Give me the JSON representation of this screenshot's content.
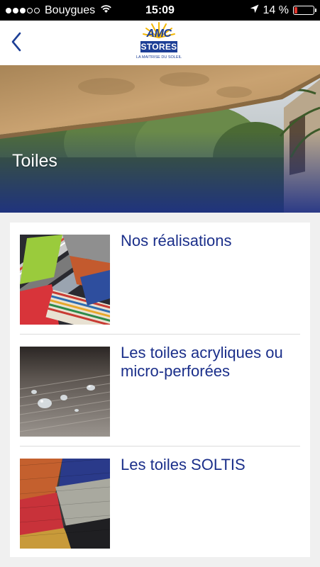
{
  "status_bar": {
    "carrier": "Bouygues",
    "time": "15:09",
    "battery_text": "14 %",
    "battery_level": 0.14,
    "signal_bars_filled": 3,
    "signal_bars_total": 5,
    "battery_color": "#e2342c"
  },
  "nav": {
    "back_icon": "chevron-left-icon",
    "logo": {
      "brand": "AMC",
      "name": "STORES",
      "tagline": "LA MAITRISE DU SOLEIL"
    }
  },
  "hero": {
    "title": "Toiles"
  },
  "list": {
    "items": [
      {
        "label": "Nos réalisations"
      },
      {
        "label": "Les toiles acryliques ou micro-perforées"
      },
      {
        "label": "Les toiles SOLTIS"
      }
    ]
  },
  "colors": {
    "accent": "#1b2f8a",
    "logo_blue": "#1d3f96",
    "background": "#f0f0f0"
  }
}
